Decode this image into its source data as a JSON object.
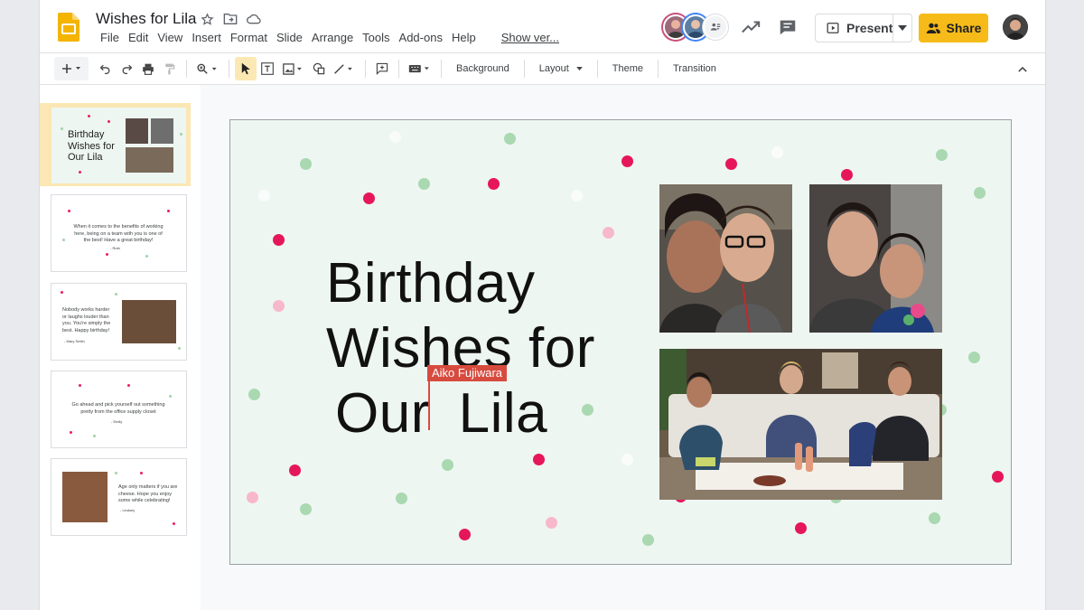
{
  "doc": {
    "title": "Wishes for Lila"
  },
  "menu": [
    "File",
    "Edit",
    "View",
    "Insert",
    "Format",
    "Slide",
    "Arrange",
    "Tools",
    "Add-ons",
    "Help"
  ],
  "show_versions": "Show ver...",
  "header": {
    "present_label": "Present",
    "share_label": "Share"
  },
  "toolbar": {
    "background": "Background",
    "layout": "Layout",
    "theme": "Theme",
    "transition": "Transition"
  },
  "slides": [
    {
      "title_lines": [
        "Birthday",
        "Wishes for",
        "Our Lila"
      ]
    },
    {
      "text": "When it comes to the benefits of working here, being on a team with you is one of the best! Have a great birthday!",
      "sig": "- Ruth"
    },
    {
      "text": "Nobody works harder or laughs louder than you. You're simply the best. Happy birthday!",
      "sig": "- Mary Smith"
    },
    {
      "text": "Go ahead and pick yourself out something pretty from the office supply closet",
      "sig": "- Emily"
    },
    {
      "text": "Age only matters if you are cheese. Hope you enjoy some while celebrating!",
      "sig": "- Lindsey"
    }
  ],
  "main_slide": {
    "title_line1": "Birthday",
    "title_line2": "Wishes for",
    "title_line3a": "Our",
    "title_line3b": "Lila",
    "collaborator": "Aiko Fujiwara"
  },
  "colors": {
    "accent": "#f6bb18",
    "dot_pink": "#e91e63",
    "dot_green": "#9fd3a8",
    "slide_bg": "#eef6f1",
    "collab": "#d74b3f"
  }
}
